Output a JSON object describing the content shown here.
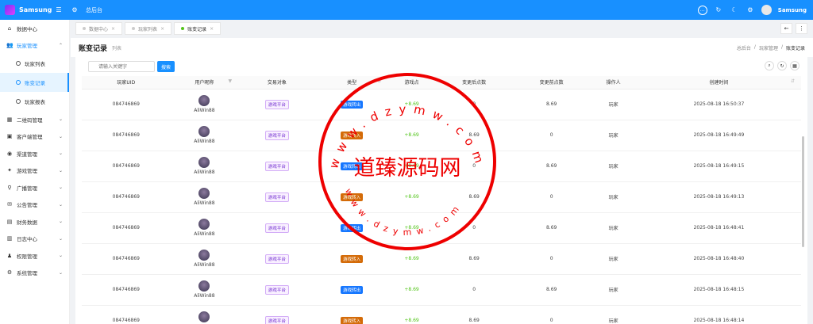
{
  "app": {
    "name": "Samsung",
    "home_link": "总后台",
    "user_name": "Samsung"
  },
  "sidebar": {
    "items": [
      {
        "label": "数据中心",
        "icon": "home-icon"
      },
      {
        "label": "玩家管理",
        "icon": "users-icon"
      },
      {
        "label": "二维码管理",
        "icon": "qrcode-icon"
      },
      {
        "label": "客户端管理",
        "icon": "client-icon"
      },
      {
        "label": "渠道管理",
        "icon": "channel-icon"
      },
      {
        "label": "游戏管理",
        "icon": "game-icon"
      },
      {
        "label": "广播管理",
        "icon": "broadcast-icon"
      },
      {
        "label": "公告管理",
        "icon": "notice-icon"
      },
      {
        "label": "财务数据",
        "icon": "finance-icon"
      },
      {
        "label": "日志中心",
        "icon": "log-icon"
      },
      {
        "label": "权限管理",
        "icon": "permission-icon"
      },
      {
        "label": "系统管理",
        "icon": "settings-icon"
      }
    ],
    "sub_items": [
      {
        "label": "玩家列表"
      },
      {
        "label": "账变记录"
      },
      {
        "label": "玩家报表"
      }
    ]
  },
  "tabs": [
    {
      "label": "数据中心"
    },
    {
      "label": "玩家列表"
    },
    {
      "label": "账变记录"
    }
  ],
  "page": {
    "title": "账变记录",
    "subtitle": "列表",
    "breadcrumb": [
      "总后台",
      "/",
      "玩家管理",
      "/",
      "账变记录"
    ]
  },
  "search": {
    "placeholder": "请输入关键字",
    "button_label": "搜索"
  },
  "table": {
    "columns": [
      "玩家UID",
      "用户昵称",
      "交易对象",
      "类型",
      "游戏点",
      "变更后点数",
      "变更前点数",
      "操作人",
      "创建时间"
    ],
    "rows": [
      {
        "uid": "084746869",
        "nickname": "AliWin88",
        "object": "游戏平台",
        "type": "游戏转出",
        "type_kind": "out",
        "points": "+8.69",
        "after": "0",
        "before": "8.69",
        "operator": "玩家",
        "time": "2025-08-18 16:50:37"
      },
      {
        "uid": "084746869",
        "nickname": "AliWin88",
        "object": "游戏平台",
        "type": "游戏转入",
        "type_kind": "in",
        "points": "+8.69",
        "after": "8.69",
        "before": "0",
        "operator": "玩家",
        "time": "2025-08-18 16:49:49"
      },
      {
        "uid": "084746869",
        "nickname": "AliWin88",
        "object": "游戏平台",
        "type": "游戏转出",
        "type_kind": "out",
        "points": "+8.69",
        "after": "0",
        "before": "8.69",
        "operator": "玩家",
        "time": "2025-08-18 16:49:15"
      },
      {
        "uid": "084746869",
        "nickname": "AliWin88",
        "object": "游戏平台",
        "type": "游戏转入",
        "type_kind": "in",
        "points": "+8.69",
        "after": "8.69",
        "before": "0",
        "operator": "玩家",
        "time": "2025-08-18 16:49:13"
      },
      {
        "uid": "084746869",
        "nickname": "AliWin88",
        "object": "游戏平台",
        "type": "游戏转出",
        "type_kind": "out",
        "points": "+8.69",
        "after": "0",
        "before": "8.69",
        "operator": "玩家",
        "time": "2025-08-18 16:48:41"
      },
      {
        "uid": "084746869",
        "nickname": "AliWin88",
        "object": "游戏平台",
        "type": "游戏转入",
        "type_kind": "in",
        "points": "+8.69",
        "after": "8.69",
        "before": "0",
        "operator": "玩家",
        "time": "2025-08-18 16:48:40"
      },
      {
        "uid": "084746869",
        "nickname": "AliWin88",
        "object": "游戏平台",
        "type": "游戏转出",
        "type_kind": "out",
        "points": "+8.69",
        "after": "0",
        "before": "8.69",
        "operator": "玩家",
        "time": "2025-08-18 16:48:15"
      },
      {
        "uid": "084746869",
        "nickname": "AliWin88",
        "object": "游戏平台",
        "type": "游戏转入",
        "type_kind": "in",
        "points": "+8.69",
        "after": "8.69",
        "before": "0",
        "operator": "玩家",
        "time": "2025-08-18 16:48:14"
      }
    ]
  },
  "watermark": {
    "text": "道臻源码网",
    "url_text": "www.dzymw.com",
    "color": "#e00000"
  }
}
